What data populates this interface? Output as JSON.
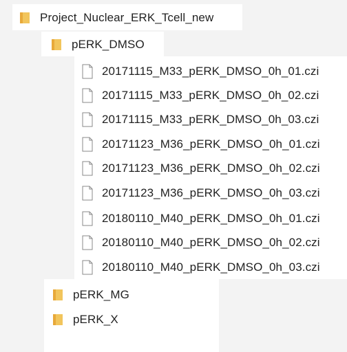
{
  "root_folder": {
    "name": "Project_Nuclear_ERK_Tcell_new",
    "icon": "folder-icon",
    "icon_color": "#f2c55c"
  },
  "subfolders": [
    {
      "name": "pERK_DMSO",
      "icon": "folder-icon",
      "expanded": true,
      "files": [
        "20171115_M33_pERK_DMSO_0h_01.czi",
        "20171115_M33_pERK_DMSO_0h_02.czi",
        "20171115_M33_pERK_DMSO_0h_03.czi",
        "20171123_M36_pERK_DMSO_0h_01.czi",
        "20171123_M36_pERK_DMSO_0h_02.czi",
        "20171123_M36_pERK_DMSO_0h_03.czi",
        "20180110_M40_pERK_DMSO_0h_01.czi",
        "20180110_M40_pERK_DMSO_0h_02.czi",
        "20180110_M40_pERK_DMSO_0h_03.czi"
      ],
      "file_icon": "document-icon"
    },
    {
      "name": "pERK_MG",
      "icon": "folder-icon",
      "expanded": false
    },
    {
      "name": "pERK_X",
      "icon": "folder-icon",
      "expanded": false
    }
  ]
}
